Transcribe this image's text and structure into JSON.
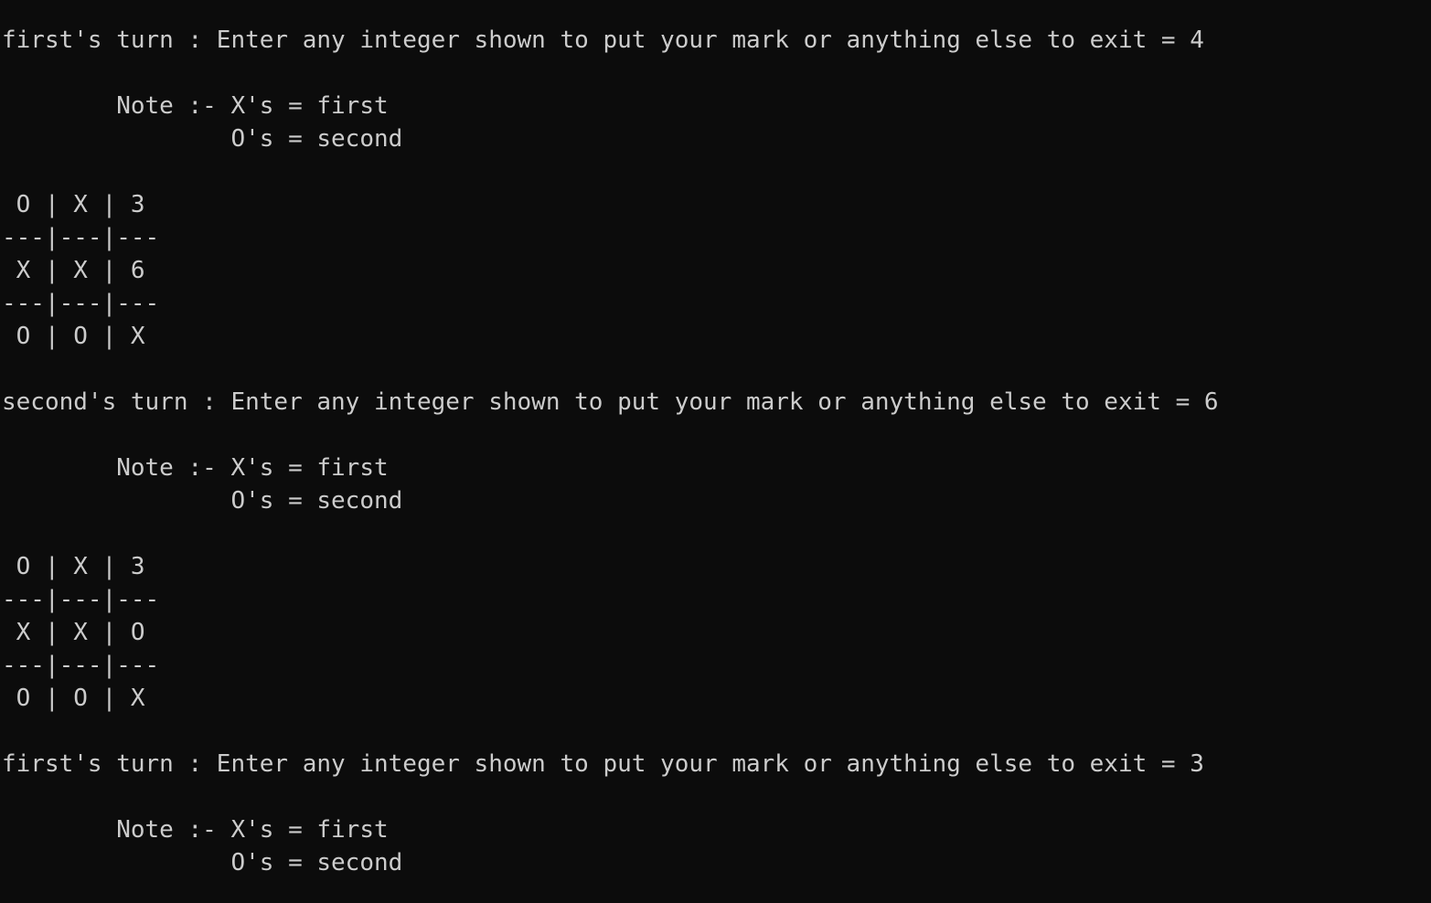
{
  "colors": {
    "background": "#0c0c0c",
    "foreground": "#cccccc"
  },
  "terminal": {
    "lines": [
      "first's turn : Enter any integer shown to put your mark or anything else to exit = 4",
      "",
      "        Note :- X's = first",
      "                O's = second",
      "",
      " O | X | 3",
      "---|---|---",
      " X | X | 6",
      "---|---|---",
      " O | O | X",
      "",
      "second's turn : Enter any integer shown to put your mark or anything else to exit = 6",
      "",
      "        Note :- X's = first",
      "                O's = second",
      "",
      " O | X | 3",
      "---|---|---",
      " X | X | O",
      "---|---|---",
      " O | O | X",
      "",
      "first's turn : Enter any integer shown to put your mark or anything else to exit = 3",
      "",
      "        Note :- X's = first",
      "                O's = second"
    ]
  }
}
